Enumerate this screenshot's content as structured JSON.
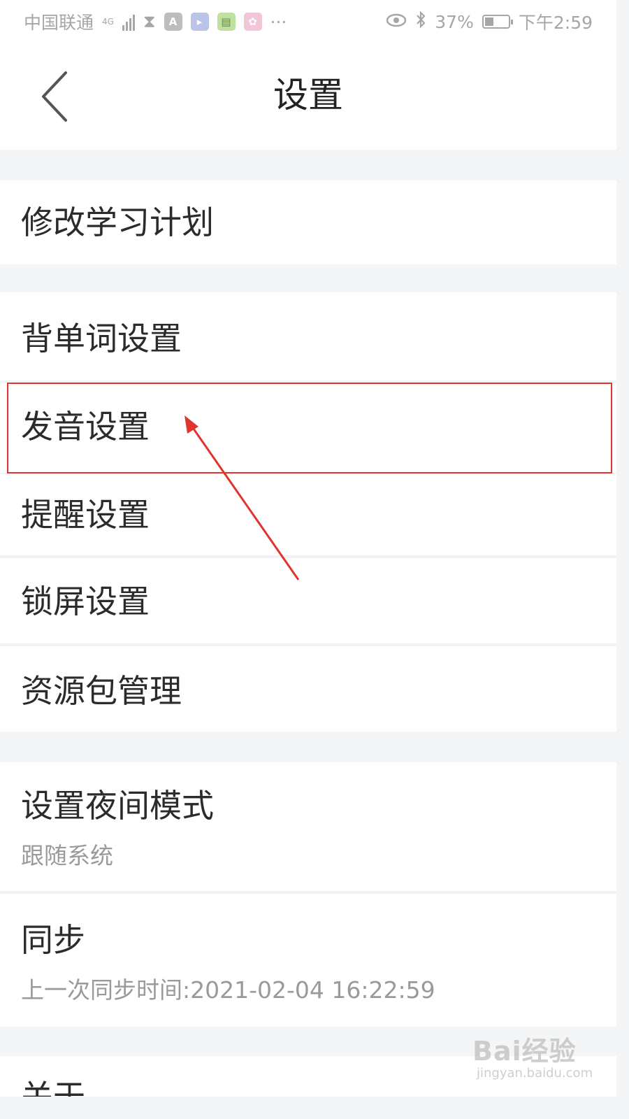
{
  "status_bar": {
    "carrier": "中国联通",
    "network": "4G",
    "battery_percent": "37%",
    "battery_level": 0.37,
    "time": "下午2:59",
    "app_icons": [
      "hourglass-icon",
      "a-icon",
      "app-icon",
      "reader-icon",
      "flower-icon",
      "more-icon"
    ],
    "more_label": "···"
  },
  "nav": {
    "title": "设置",
    "back_icon": "chevron-left-icon"
  },
  "settings": {
    "study_plan": "修改学习计划",
    "word_settings": "背单词设置",
    "pronunciation": "发音设置",
    "reminder": "提醒设置",
    "lock_screen": "锁屏设置",
    "resource_pack": "资源包管理",
    "night_mode": {
      "label": "设置夜间模式",
      "value": "跟随系统"
    },
    "sync": {
      "label": "同步",
      "value": "上一次同步时间:2021-02-04 16:22:59"
    },
    "about": "关于"
  },
  "annotation": {
    "highlight_color": "#e0352f"
  },
  "watermark": {
    "brand": "Bai经验",
    "url": "jingyan.baidu.com"
  }
}
